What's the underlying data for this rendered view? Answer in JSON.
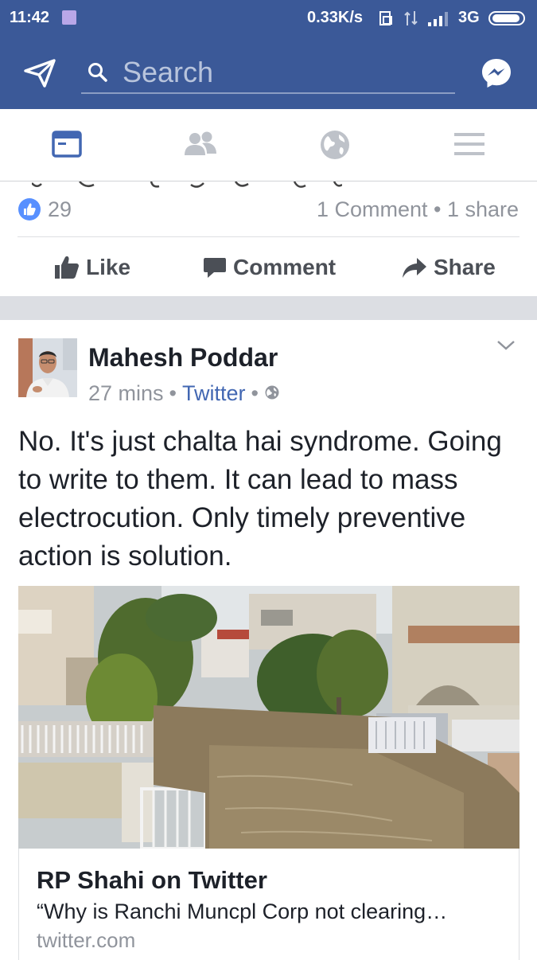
{
  "status_bar": {
    "time": "11:42",
    "network_speed": "0.33K/s",
    "network_type": "3G",
    "icons": [
      "notification-icon",
      "screen-rotate-icon",
      "data-arrows-icon",
      "signal-icon",
      "battery-icon"
    ]
  },
  "header": {
    "search_placeholder": "Search",
    "icons": [
      "send-icon",
      "search-icon",
      "messenger-icon"
    ]
  },
  "tabs": [
    {
      "name": "news-feed",
      "icon": "news-feed-icon",
      "active": true
    },
    {
      "name": "friends",
      "icon": "friends-icon",
      "active": false
    },
    {
      "name": "notifications",
      "icon": "globe-icon",
      "active": false
    },
    {
      "name": "menu",
      "icon": "menu-icon",
      "active": false
    }
  ],
  "prev_post": {
    "like_count": "29",
    "stats": "1 Comment • 1 share",
    "actions": {
      "like": "Like",
      "comment": "Comment",
      "share": "Share"
    }
  },
  "post": {
    "author": "Mahesh Poddar",
    "time": "27 mins",
    "source": "Twitter",
    "separator": "•",
    "text": "No. It's just chalta hai  syndrome. Going to write to them. It can lead to mass electrocution. Only timely preventive action is solution.",
    "link": {
      "title": "RP Shahi on Twitter",
      "description": "“Why is Ranchi Muncpl Corp not clearing…",
      "domain": "twitter.com"
    }
  },
  "colors": {
    "brand_blue": "#3b5998",
    "link_blue": "#4267b2",
    "meta_gray": "#90949c",
    "like_blue": "#5890ff"
  }
}
